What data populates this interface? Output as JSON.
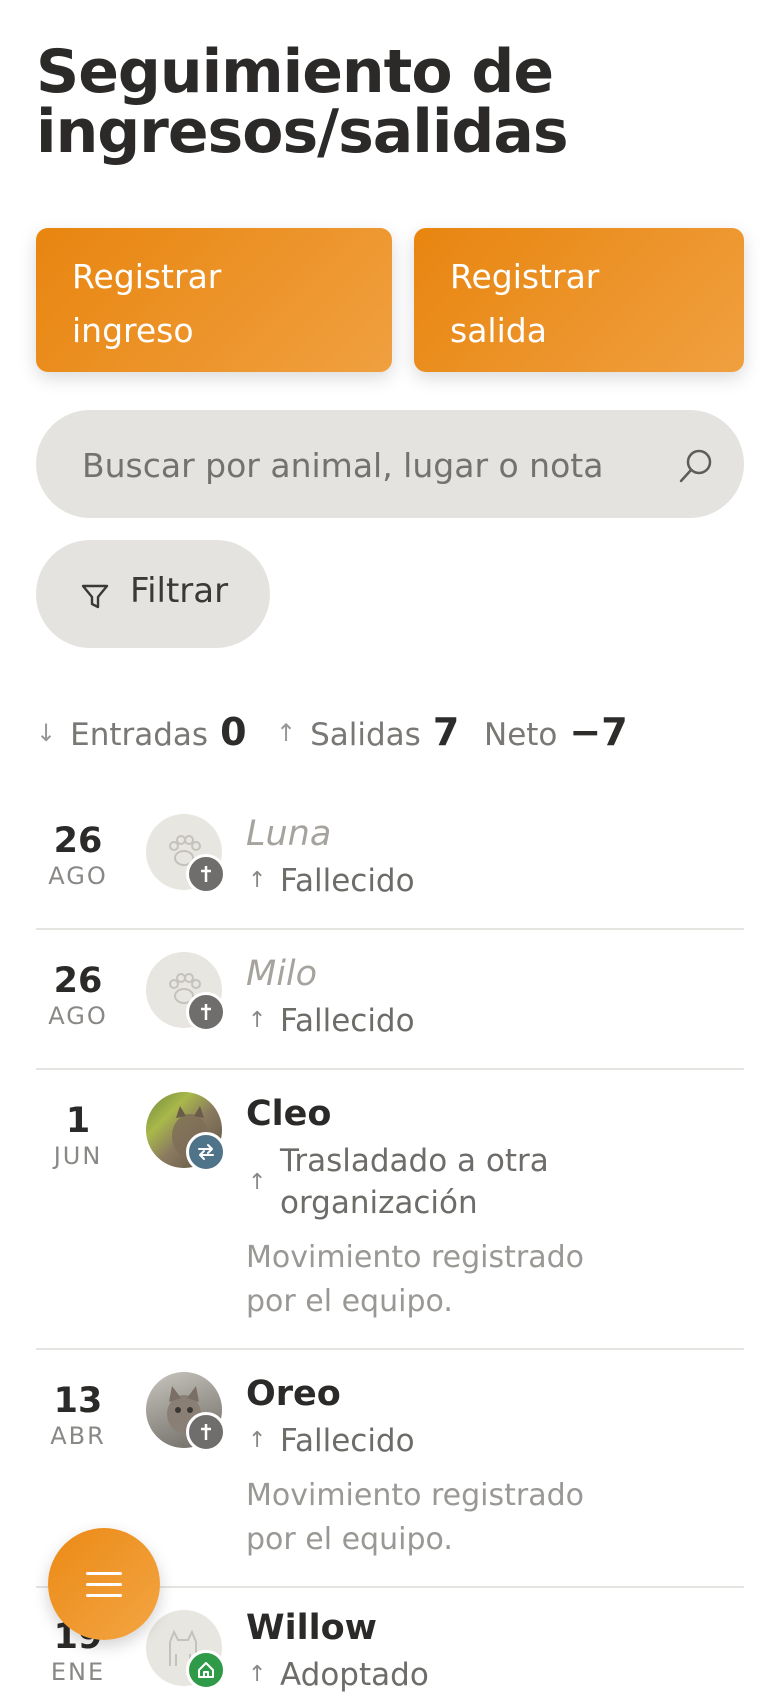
{
  "header": {
    "title_line1": "Seguimiento de",
    "title_line2": "ingresos/salidas"
  },
  "actions": {
    "register_in_line1": "Registrar",
    "register_in_line2": "ingreso",
    "register_out_line1": "Registrar",
    "register_out_line2": "salida"
  },
  "search": {
    "placeholder": "Buscar por animal, lugar o nota",
    "value": ""
  },
  "filter": {
    "label": "Filtrar"
  },
  "stats": {
    "in_label": "Entradas",
    "in_value": "0",
    "out_label": "Salidas",
    "out_value": "7",
    "net_label": "Neto",
    "net_value": "−7"
  },
  "movements": [
    {
      "day": "26",
      "month": "AGO",
      "name": "Luna",
      "reason": "Fallecido",
      "note": "",
      "avatar": "paw-placeholder",
      "status_icon": "cross-icon"
    },
    {
      "day": "26",
      "month": "AGO",
      "name": "Milo",
      "reason": "Fallecido",
      "note": "",
      "avatar": "paw-placeholder",
      "status_icon": "cross-icon"
    },
    {
      "day": "1",
      "month": "JUN",
      "name": "Cleo",
      "reason_line1": "Trasladado a otra",
      "reason_line2": "organización",
      "note_line1": "Movimiento registrado",
      "note_line2": "por el equipo.",
      "avatar": "cat-photo",
      "status_icon": "transfer-icon"
    },
    {
      "day": "13",
      "month": "ABR",
      "name": "Oreo",
      "reason": "Fallecido",
      "note_line1": "Movimiento registrado",
      "note_line2": "por el equipo.",
      "avatar": "cat-photo",
      "status_icon": "cross-icon"
    },
    {
      "day": "19",
      "month": "ENE",
      "name": "Willow",
      "reason": "Adoptado",
      "avatar": "cat-placeholder",
      "status_icon": "home-icon"
    }
  ],
  "colors": {
    "accent": "#ed8f1e",
    "badge_gray": "#6f6e6c",
    "badge_blue": "#4f7389",
    "badge_green": "#2f9a48"
  }
}
